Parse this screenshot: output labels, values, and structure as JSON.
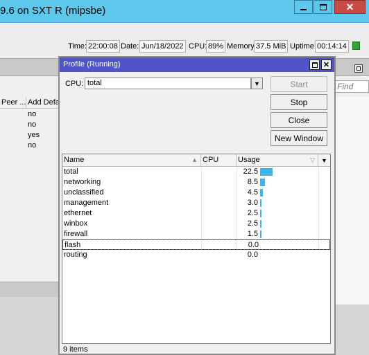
{
  "window": {
    "title": "9.6 on SXT R (mipsbe)",
    "close_glyph": "✕"
  },
  "status_bar": {
    "time_label": "Time:",
    "time_value": "22:00:08",
    "date_label": "Date:",
    "date_value": "Jun/18/2022",
    "cpu_label": "CPU:",
    "cpu_value": "89%",
    "memory_label": "Memory:",
    "memory_value": "37.5 MiB",
    "uptime_label": "Uptime:",
    "uptime_value": "00:14:14",
    "indicator_color": "#2fa832"
  },
  "background_window": {
    "columns": [
      "Peer ...",
      "Add Defa"
    ],
    "rows": [
      "no",
      "no",
      "yes",
      "no"
    ],
    "find_placeholder": "Find"
  },
  "profile": {
    "title": "Profile (Running)",
    "close_glyph": "✕",
    "cpu_label": "CPU:",
    "cpu_value": "total",
    "dropdown_glyph": "▼",
    "buttons": {
      "start": "Start",
      "stop": "Stop",
      "close": "Close",
      "new_window": "New Window"
    },
    "columns": {
      "name": "Name",
      "cpu": "CPU",
      "usage": "Usage"
    },
    "sort_mark": "▲",
    "filter_mark": "▽",
    "header_drop": "▼",
    "rows": [
      {
        "name": "total",
        "cpu": "",
        "usage": "22.5",
        "pct": 22.5
      },
      {
        "name": "networking",
        "cpu": "",
        "usage": "8.5",
        "pct": 8.5
      },
      {
        "name": "unclassified",
        "cpu": "",
        "usage": "4.5",
        "pct": 4.5
      },
      {
        "name": "management",
        "cpu": "",
        "usage": "3.0",
        "pct": 3.0
      },
      {
        "name": "ethernet",
        "cpu": "",
        "usage": "2.5",
        "pct": 2.5
      },
      {
        "name": "winbox",
        "cpu": "",
        "usage": "2.5",
        "pct": 2.5
      },
      {
        "name": "firewall",
        "cpu": "",
        "usage": "1.5",
        "pct": 1.5
      },
      {
        "name": "flash",
        "cpu": "",
        "usage": "0.0",
        "pct": 0.0
      },
      {
        "name": "routing",
        "cpu": "",
        "usage": "0.0",
        "pct": 0.0
      }
    ],
    "item_count": "9 items",
    "bar_color": "#3cb5ea"
  }
}
